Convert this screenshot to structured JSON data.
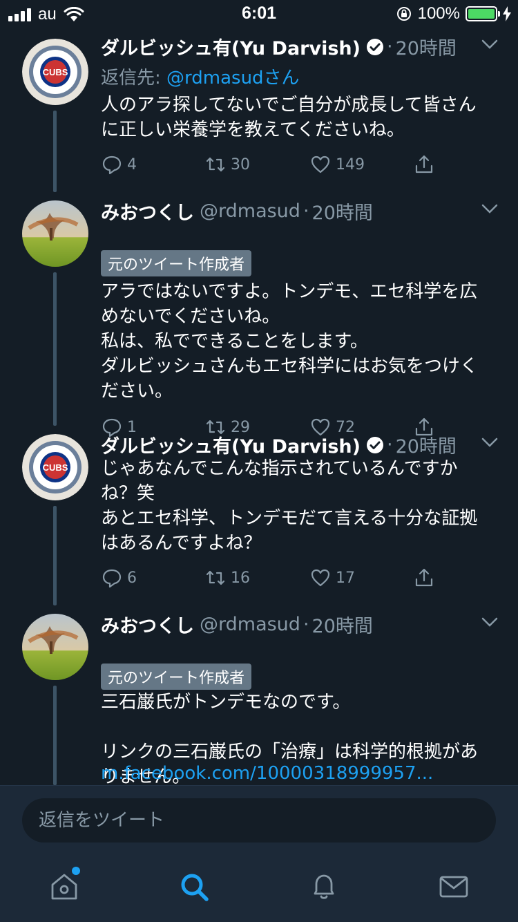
{
  "status_bar": {
    "carrier": "au",
    "time": "6:01",
    "battery": "100%"
  },
  "colors": {
    "background": "#141d26",
    "accent": "#1da1f2",
    "secondary_text": "#8899a6",
    "battery": "#4cd964"
  },
  "tweets": [
    {
      "name": "ダルビッシュ有(Yu Darvish)",
      "verified": true,
      "handle": "",
      "time": "20時間",
      "reply_label": "返信先: ",
      "reply_to": "@rdmasudさん",
      "body": "人のアラ探してないでご自分が成長して皆さん\nに正しい栄養学を教えてくださいね。",
      "replies": "4",
      "retweets": "30",
      "likes": "149"
    },
    {
      "name": "みおつくし",
      "handle": "@rdmasud",
      "time": "20時間",
      "badge": "元のツイート作成者",
      "body": "アラではないですよ。トンデモ、エセ科学を広\nめないでくださいね。\n私は、私でできることをします。\nダルビッシュさんもエセ科学にはお気をつけく\nださい。",
      "replies": "1",
      "retweets": "29",
      "likes": "72"
    },
    {
      "name": "ダルビッシュ有(Yu Darvish)",
      "verified": true,
      "time": "20時間",
      "body": "じゃあなんでこんな指示されているんですか\nね？笑\nあとエセ科学、トンデモだて言える十分な証拠\nはあるんですよね？",
      "replies": "6",
      "retweets": "16",
      "likes": "17"
    },
    {
      "name": "みおつくし",
      "handle": "@rdmasud",
      "time": "20時間",
      "badge": "元のツイート作成者",
      "body": "三石巌氏がトンデモなのです。\n\nリンクの三石巌氏の「治療」は科学的根拠があ\nりません。",
      "link": "m.facebook.com/10000318999957..."
    }
  ],
  "avatar_text": "CUBS",
  "compose": {
    "placeholder": "返信をツイート"
  },
  "tabbar": {
    "items": [
      "home",
      "search",
      "notifications",
      "messages"
    ],
    "active": "search"
  }
}
